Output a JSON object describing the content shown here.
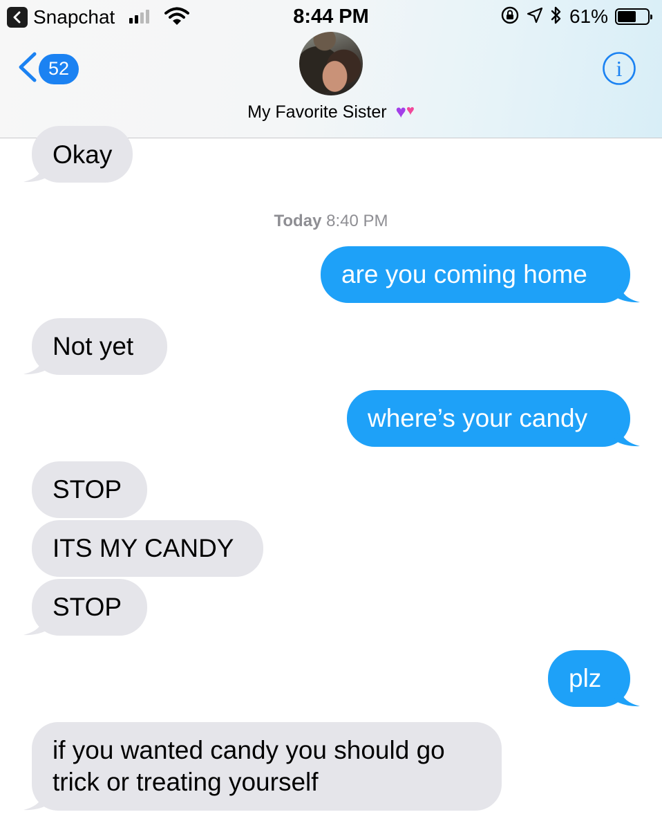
{
  "status_bar": {
    "back_app_label": "Snapchat",
    "time": "8:44 PM",
    "battery_percent": "61%",
    "battery_level": 0.61,
    "signal_bars_filled": 2,
    "signal_bars_total": 4
  },
  "nav": {
    "unread_count": "52",
    "contact_name": "My Favorite Sister",
    "contact_emoji_1": "♥",
    "contact_emoji_2": "♥",
    "info_label": "i",
    "accent_color": "#1b82f2"
  },
  "thread": {
    "timestamp_day": "Today",
    "timestamp_time": "8:40 PM",
    "messages": [
      {
        "from": "them",
        "text": "Okay"
      },
      {
        "from": "me",
        "text": "are you coming home"
      },
      {
        "from": "them",
        "text": "Not yet"
      },
      {
        "from": "me",
        "text": "where’s your candy"
      },
      {
        "from": "them",
        "text": "STOP"
      },
      {
        "from": "them",
        "text": "ITS MY CANDY"
      },
      {
        "from": "them",
        "text": "STOP"
      },
      {
        "from": "me",
        "text": "plz"
      },
      {
        "from": "them",
        "text_line_1": "if you wanted candy you should go",
        "text_line_2": "trick or treating yourself"
      }
    ]
  },
  "colors": {
    "incoming_bubble": "#e5e5ea",
    "outgoing_bubble": "#1ea1f8"
  }
}
